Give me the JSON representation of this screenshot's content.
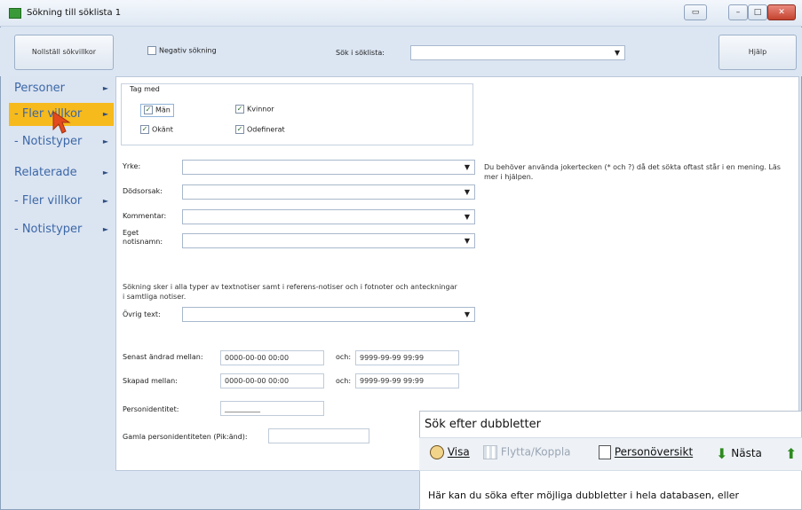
{
  "window": {
    "title": "Sökning till söklista 1"
  },
  "toolbar": {
    "reset_label": "Nollställ sökvillkor",
    "negative_search_label": "Negativ sökning",
    "search_in_list_label": "Sök i söklista:",
    "search_in_list_value": "",
    "help_label": "Hjälp"
  },
  "sidebar": {
    "items": [
      {
        "label": "Personer"
      },
      {
        "label": "- Fler villkor"
      },
      {
        "label": "- Notistyper"
      },
      {
        "label": "Relaterade"
      },
      {
        "label": "- Fler villkor"
      },
      {
        "label": "- Notistyper"
      }
    ]
  },
  "include": {
    "legend": "Tag med",
    "men": "Män",
    "women": "Kvinnor",
    "unknown": "Okänt",
    "undefined": "Odefinerat"
  },
  "fields": {
    "occupation_label": "Yrke:",
    "cause_of_death_label": "Dödsorsak:",
    "comment_label": "Kommentar:",
    "own_note_label": "Eget notisnamn:",
    "note_hint": "Sökning sker i alla typer av textnotiser samt i referens-notiser och i fotnoter och anteckningar i samtliga notiser.",
    "other_text_label": "Övrig text:",
    "jokers_hint": "Du behöver använda jokertecken (* och ?) då det sökta oftast står i en mening. Läs mer i hjälpen.",
    "changed_label": "Senast ändrad mellan:",
    "changed_from": "0000-00-00 00:00",
    "and_label": "och:",
    "changed_to": "9999-99-99 99:99",
    "created_label": "Skapad mellan:",
    "created_from": "0000-00-00 00:00",
    "created_to": "9999-99-99 99:99",
    "personid_label": "Personidentitet:",
    "personid_value": "__________",
    "old_personid_label": "Gamla personidentiteten (Pik:änd):",
    "old_personid_value": ""
  },
  "duplicates": {
    "title": "Sök efter dubbletter",
    "show": "Visa",
    "move": "Flytta/Koppla",
    "overview": "Personöversikt",
    "next": "Nästa",
    "body": "Här kan du söka efter möjliga dubbletter i hela databasen, eller"
  },
  "colors": {
    "active_sidebar": "#f6ba1d",
    "sidebar_text": "#3c68a8"
  }
}
